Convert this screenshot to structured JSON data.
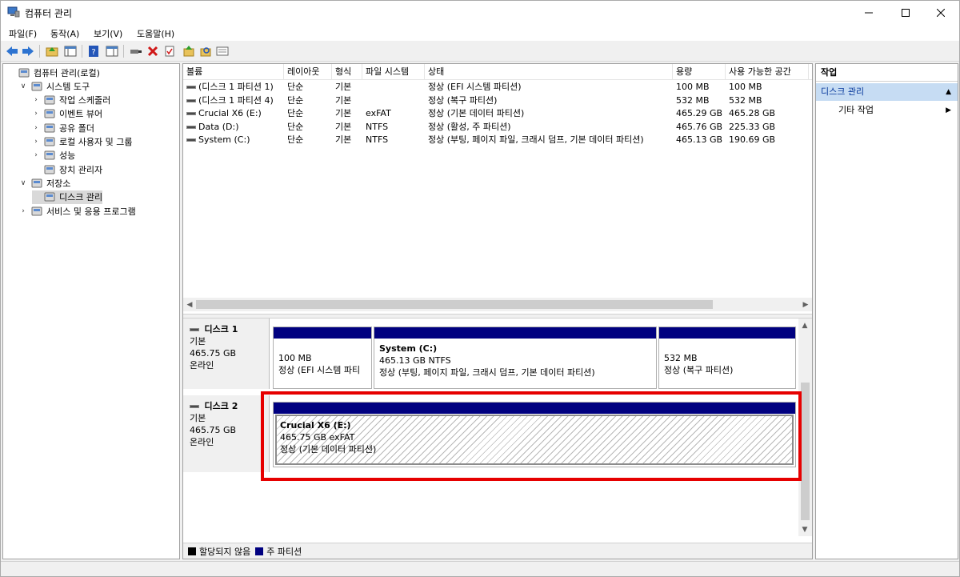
{
  "window": {
    "title": "컴퓨터 관리"
  },
  "menu": [
    "파일(F)",
    "동작(A)",
    "보기(V)",
    "도움말(H)"
  ],
  "toolbar_icons": [
    "back-arrow-icon",
    "forward-arrow-icon",
    "folder-up-icon",
    "show-hide-console-tree-icon",
    "help-icon",
    "show-hide-action-pane-icon",
    "connect-icon",
    "delete-icon",
    "properties-icon",
    "up-icon",
    "search-icon",
    "view-icon"
  ],
  "tree": [
    {
      "label": "컴퓨터 관리(로컬)",
      "indent": 0,
      "expander": "",
      "icon": "computer-management-icon"
    },
    {
      "label": "시스템 도구",
      "indent": 1,
      "expander": "v",
      "icon": "system-tools-icon"
    },
    {
      "label": "작업 스케줄러",
      "indent": 2,
      "expander": ">",
      "icon": "task-scheduler-icon"
    },
    {
      "label": "이벤트 뷰어",
      "indent": 2,
      "expander": ">",
      "icon": "event-viewer-icon"
    },
    {
      "label": "공유 폴더",
      "indent": 2,
      "expander": ">",
      "icon": "shared-folders-icon"
    },
    {
      "label": "로컬 사용자 및 그룹",
      "indent": 2,
      "expander": ">",
      "icon": "local-users-icon"
    },
    {
      "label": "성능",
      "indent": 2,
      "expander": ">",
      "icon": "performance-icon"
    },
    {
      "label": "장치 관리자",
      "indent": 2,
      "expander": "",
      "icon": "device-manager-icon"
    },
    {
      "label": "저장소",
      "indent": 1,
      "expander": "v",
      "icon": "storage-icon"
    },
    {
      "label": "디스크 관리",
      "indent": 2,
      "expander": "",
      "icon": "disk-management-icon",
      "selected": true
    },
    {
      "label": "서비스 및 응용 프로그램",
      "indent": 1,
      "expander": ">",
      "icon": "services-apps-icon"
    }
  ],
  "volume_list": {
    "columns": [
      "볼륨",
      "레이아웃",
      "형식",
      "파일 시스템",
      "상태",
      "용량",
      "사용 가능한 공간"
    ],
    "rows": [
      {
        "volume": "(디스크 1 파티션 1)",
        "layout": "단순",
        "type": "기본",
        "fs": "",
        "status": "정상 (EFI 시스템 파티션)",
        "capacity": "100 MB",
        "free": "100 MB"
      },
      {
        "volume": "(디스크 1 파티션 4)",
        "layout": "단순",
        "type": "기본",
        "fs": "",
        "status": "정상 (복구 파티션)",
        "capacity": "532 MB",
        "free": "532 MB"
      },
      {
        "volume": "Crucial X6 (E:)",
        "layout": "단순",
        "type": "기본",
        "fs": "exFAT",
        "status": "정상 (기본 데이터 파티션)",
        "capacity": "465.29 GB",
        "free": "465.28 GB"
      },
      {
        "volume": "Data (D:)",
        "layout": "단순",
        "type": "기본",
        "fs": "NTFS",
        "status": "정상 (활성, 주 파티션)",
        "capacity": "465.76 GB",
        "free": "225.33 GB"
      },
      {
        "volume": "System (C:)",
        "layout": "단순",
        "type": "기본",
        "fs": "NTFS",
        "status": "정상 (부팅, 페이지 파일, 크래시 덤프, 기본 데이터 파티션)",
        "capacity": "465.13 GB",
        "free": "190.69 GB"
      }
    ]
  },
  "disks": [
    {
      "name": "디스크 1",
      "type": "기본",
      "size": "465.75 GB",
      "state": "온라인",
      "partitions": [
        {
          "title": "",
          "line1": "100 MB",
          "line2": "정상 (EFI 시스템 파티"
        },
        {
          "title": "System  (C:)",
          "line1": "465.13 GB NTFS",
          "line2": "정상 (부팅, 페이지 파일, 크래시 덤프, 기본 데이터 파티션)"
        },
        {
          "title": "",
          "line1": "532 MB",
          "line2": "정상 (복구 파티션)"
        }
      ]
    },
    {
      "name": "디스크 2",
      "type": "기본",
      "size": "465.75 GB",
      "state": "온라인",
      "partitions": [
        {
          "title": "Crucial X6  (E:)",
          "line1": "465.75 GB exFAT",
          "line2": "정상 (기본 데이터 파티션)"
        }
      ]
    }
  ],
  "legend": {
    "unallocated": "할당되지 않음",
    "primary": "주 파티션",
    "unallocated_color": "#000000",
    "primary_color": "#000080"
  },
  "actions": {
    "header": "작업",
    "section": "디스크 관리",
    "item": "기타 작업"
  },
  "colors": {
    "partition_bar": "#000080",
    "highlight": "#e60000",
    "action_section_bg": "#c6dcf3"
  }
}
